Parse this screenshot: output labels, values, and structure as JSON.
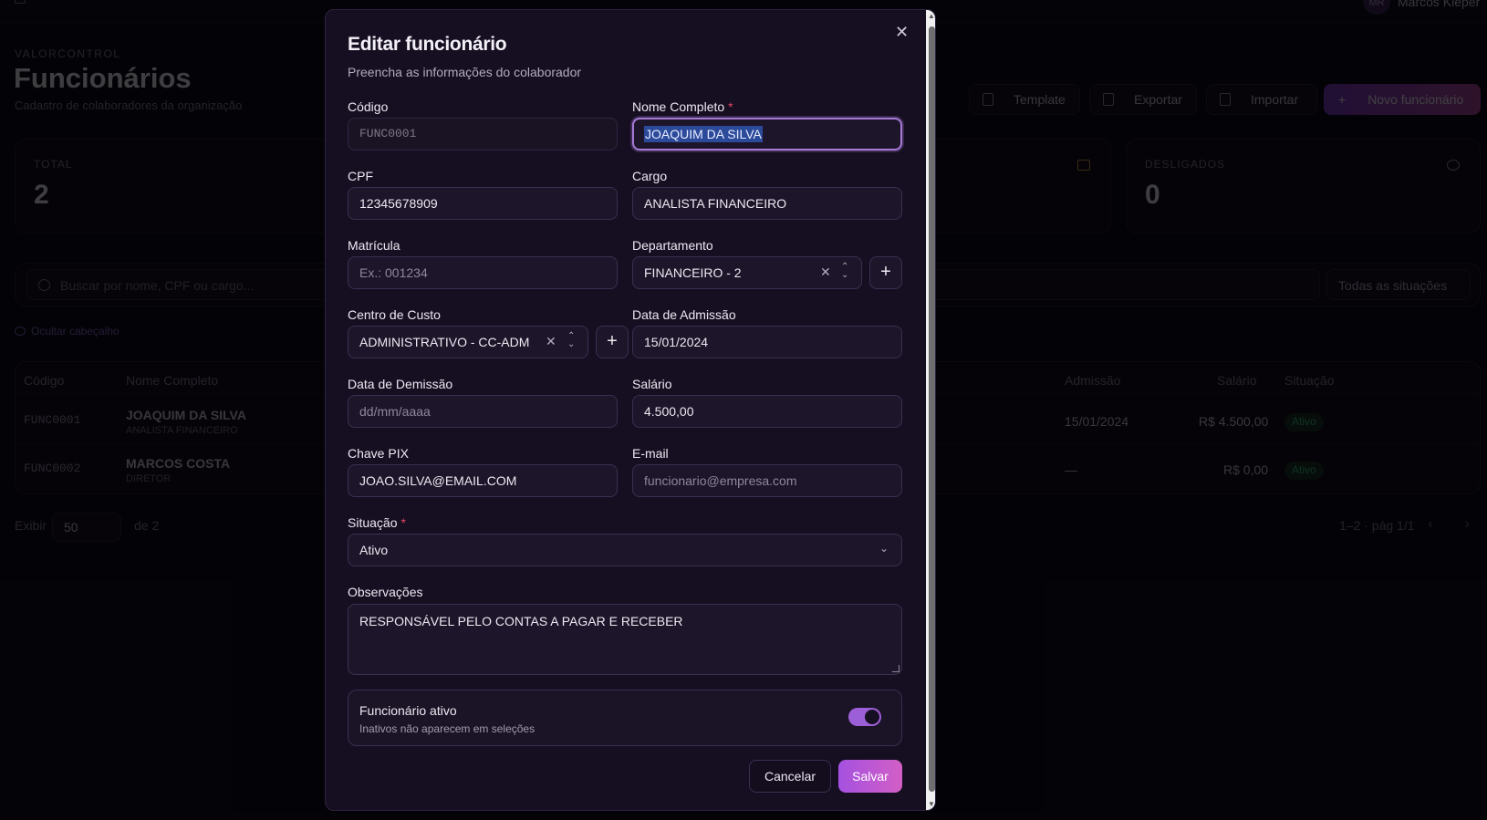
{
  "topbar": {
    "avatar_initials": "MR",
    "user_name": "Marcos Kleper"
  },
  "page": {
    "org": "VALORCONTROL",
    "title": "Funcionários",
    "subtitle": "Cadastro de colaboradores da organização",
    "actions": {
      "template": "Template",
      "export": "Exportar",
      "import": "Importar",
      "new": "Novo funcionário"
    }
  },
  "stats": {
    "total_label": "TOTAL",
    "total_value": "2",
    "dismissed_label": "DESLIGADOS",
    "dismissed_value": "0"
  },
  "filters": {
    "search_placeholder": "Buscar por nome, CPF ou cargo...",
    "status": "Todas as situações",
    "hide_header": "Ocultar cabeçalho"
  },
  "table": {
    "columns": {
      "code": "Código",
      "name": "Nome Completo",
      "admission": "Admissão",
      "salary": "Salário",
      "status": "Situação"
    },
    "rows": [
      {
        "code": "FUNC0001",
        "name": "JOAQUIM DA SILVA",
        "role": "ANALISTA FINANCEIRO",
        "admission": "15/01/2024",
        "salary": "R$ 4.500,00",
        "status": "Ativo"
      },
      {
        "code": "FUNC0002",
        "name": "MARCOS COSTA",
        "role": "DIRETOR",
        "admission": "—",
        "salary": "R$ 0,00",
        "status": "Ativo"
      }
    ]
  },
  "pagination": {
    "show": "Exibir",
    "page_size": "50",
    "of": "de 2",
    "range": "1–2 · pág 1/1"
  },
  "modal": {
    "title": "Editar funcionário",
    "subtitle": "Preencha as informações do colaborador",
    "fields": {
      "code_label": "Código",
      "code_placeholder": "FUNC0001",
      "name_label": "Nome Completo",
      "name_value": "JOAQUIM DA SILVA",
      "cpf_label": "CPF",
      "cpf_value": "12345678909",
      "role_label": "Cargo",
      "role_value": "ANALISTA FINANCEIRO",
      "registration_label": "Matrícula",
      "registration_placeholder": "Ex.: 001234",
      "department_label": "Departamento",
      "department_value": "FINANCEIRO - 2",
      "cost_center_label": "Centro de Custo",
      "cost_center_value": "ADMINISTRATIVO - CC-ADM",
      "admission_label": "Data de Admissão",
      "admission_value": "15/01/2024",
      "dismissal_label": "Data de Demissão",
      "dismissal_placeholder": "dd/mm/aaaa",
      "salary_label": "Salário",
      "salary_value": "4.500,00",
      "pix_label": "Chave PIX",
      "pix_value": "JOAO.SILVA@EMAIL.COM",
      "email_label": "E-mail",
      "email_placeholder": "funcionario@empresa.com",
      "status_label": "Situação",
      "status_value": "Ativo",
      "notes_label": "Observações",
      "notes_value": "RESPONSÁVEL PELO CONTAS A PAGAR E RECEBER",
      "required_mark": "*"
    },
    "active_switch": {
      "title": "Funcionário ativo",
      "subtitle": "Inativos não aparecem em seleções",
      "on": true
    },
    "buttons": {
      "cancel": "Cancelar",
      "save": "Salvar"
    }
  }
}
